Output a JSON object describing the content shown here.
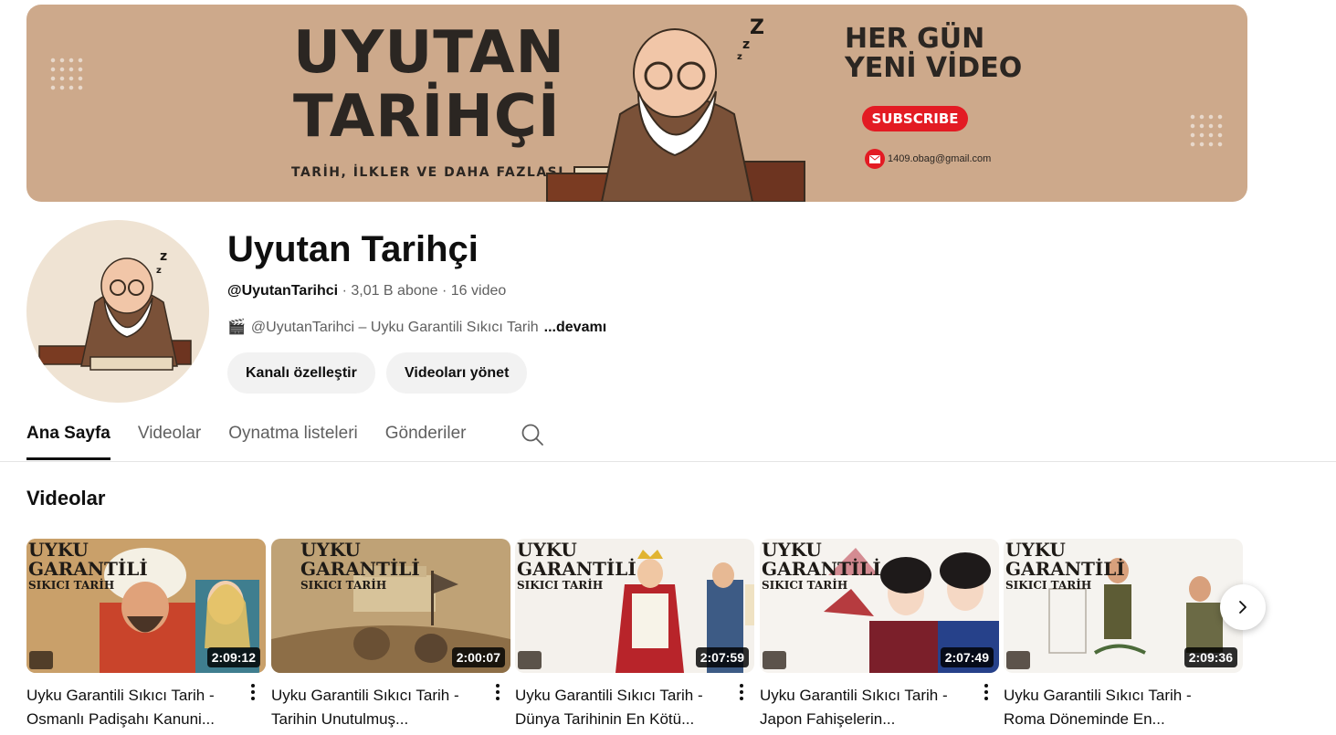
{
  "banner": {
    "title": "UYUTAN TARİHÇİ",
    "subtitle": "TARİH, İLKLER VE DAHA FAZLASI",
    "right_line1": "HER GÜN",
    "right_line2": "YENİ VİDEO",
    "subscribe": "SUBSCRIBE",
    "email": "1409.obag@gmail.com",
    "bg_color": "#cda98b"
  },
  "channel": {
    "name": "Uyutan Tarihçi",
    "handle": "@UyutanTarihci",
    "subscribers": "3,01 B abone",
    "video_count": "16 video",
    "description_icon": "🎬",
    "description": "@UyutanTarihci – Uyku Garantili Sıkıcı Tarih",
    "more": "...devamı",
    "customize_button": "Kanalı özelleştir",
    "manage_button": "Videoları yönet"
  },
  "tabs": [
    {
      "label": "Ana Sayfa",
      "active": true
    },
    {
      "label": "Videolar",
      "active": false
    },
    {
      "label": "Oynatma listeleri",
      "active": false
    },
    {
      "label": "Gönderiler",
      "active": false
    }
  ],
  "section_title": "Videolar",
  "videos": [
    {
      "thumb_line1": "UYKU",
      "thumb_line2": "GARANTİLİ",
      "thumb_line3": "SIKICI TARİH",
      "duration": "2:09:12",
      "title": "Uyku Garantili Sıkıcı Tarih - Osmanlı Padişahı Kanuni...",
      "bg": "#c9a06a"
    },
    {
      "thumb_line1": "UYKU",
      "thumb_line2": "GARANTİLİ",
      "thumb_line3": "SIKICI TARİH",
      "duration": "2:00:07",
      "title": "Uyku Garantili Sıkıcı Tarih - Tarihin Unutulmuş...",
      "bg": "#b89a6e"
    },
    {
      "thumb_line1": "UYKU",
      "thumb_line2": "GARANTİLİ",
      "thumb_line3": "SIKICI TARİH",
      "duration": "2:07:59",
      "title": "Uyku Garantili Sıkıcı Tarih - Dünya Tarihinin En Kötü...",
      "bg": "#f4f1ec"
    },
    {
      "thumb_line1": "UYKU",
      "thumb_line2": "GARANTİLİ",
      "thumb_line3": "SIKICI TARİH",
      "duration": "2:07:49",
      "title": "Uyku Garantili Sıkıcı Tarih - Japon Fahişelerin...",
      "bg": "#f6f3ef"
    },
    {
      "thumb_line1": "UYKU",
      "thumb_line2": "GARANTİLİ",
      "thumb_line3": "SIKICI TARİH",
      "duration": "2:09:36",
      "title": "Uyku Garantili Sıkıcı Tarih - Roma Döneminde En...",
      "bg": "#f5f3ef"
    }
  ]
}
